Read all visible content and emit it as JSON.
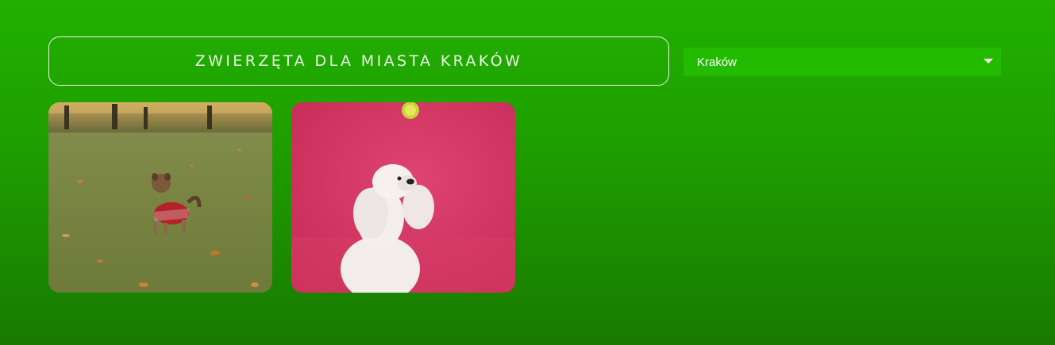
{
  "header": {
    "title": "ZWIERZĘTA DLA MIASTA KRAKÓW"
  },
  "city_select": {
    "selected": "Kraków",
    "icon": "caret-down-icon"
  },
  "pets": [
    {
      "image": "yorkshire-terrier-in-park-photo"
    },
    {
      "image": "white-poodle-pink-background-photo"
    }
  ]
}
